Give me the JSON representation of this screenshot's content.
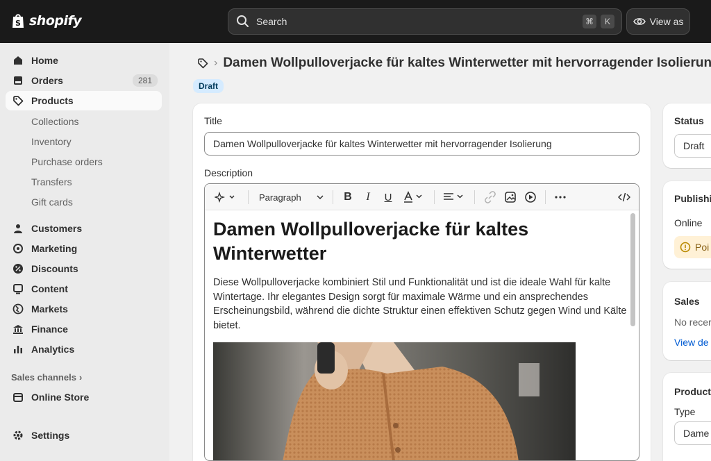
{
  "topbar": {
    "logo_text": "shopify",
    "search_placeholder": "Search",
    "search_shortcut_1": "⌘",
    "search_shortcut_2": "K",
    "view_as_label": "View as"
  },
  "sidebar": {
    "items": [
      {
        "label": "Home",
        "icon": "home-icon"
      },
      {
        "label": "Orders",
        "icon": "orders-icon",
        "badge": "281"
      },
      {
        "label": "Products",
        "icon": "tag-icon",
        "active": true
      },
      {
        "label": "Customers",
        "icon": "person-icon"
      },
      {
        "label": "Marketing",
        "icon": "target-icon"
      },
      {
        "label": "Discounts",
        "icon": "discount-icon"
      },
      {
        "label": "Content",
        "icon": "content-icon"
      },
      {
        "label": "Markets",
        "icon": "globe-icon"
      },
      {
        "label": "Finance",
        "icon": "bank-icon"
      },
      {
        "label": "Analytics",
        "icon": "chart-icon"
      }
    ],
    "sub_items": [
      "Collections",
      "Inventory",
      "Purchase orders",
      "Transfers",
      "Gift cards"
    ],
    "sales_channels_label": "Sales channels",
    "online_store_label": "Online Store",
    "settings_label": "Settings"
  },
  "main": {
    "page_title": "Damen Wollpulloverjacke für kaltes Winterwetter mit hervorragender Isolierung",
    "status_badge": "Draft",
    "title_label": "Title",
    "title_value": "Damen Wollpulloverjacke für kaltes Winterwetter mit hervorragender Isolierung",
    "description_label": "Description",
    "toolbar": {
      "paragraph_label": "Paragraph"
    },
    "editor": {
      "heading": "Damen Wollpulloverjacke für kaltes Winterwetter",
      "paragraph": "Diese Wollpulloverjacke kombiniert Stil und Funktionalität und ist die ideale Wahl für kalte Wintertage. Ihr elegantes Design sorgt für maximale Wärme und ein ansprechendes Erscheinungsbild, während die dichte Struktur einen effektiven Schutz gegen Wind und Kälte bietet."
    }
  },
  "right": {
    "status_title": "Status",
    "status_value": "Draft",
    "publishing_title": "Publishing",
    "publishing_online": "Online",
    "publishing_warning": "Poi",
    "sales_title": "Sales",
    "sales_text": "No recer",
    "sales_link": "View de",
    "product_org_title": "Product",
    "type_label": "Type",
    "type_value": "Dame"
  },
  "colors": {
    "topbar_bg": "#1a1a1a",
    "sidebar_bg": "#ebebeb",
    "badge_bg": "#d5ebff",
    "link": "#005bd3"
  }
}
